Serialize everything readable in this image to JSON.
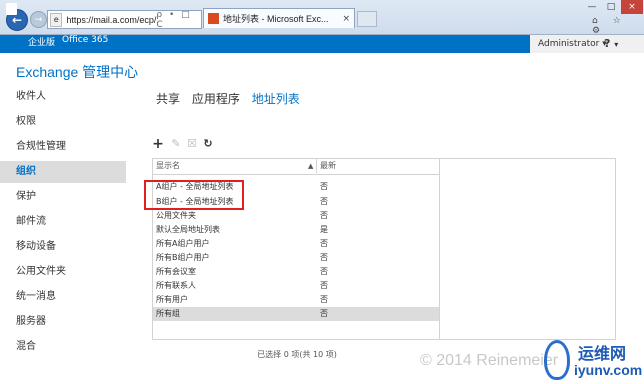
{
  "browser": {
    "url": "https://mail.a.com/ecp/",
    "address_tools": "ρ • □ C",
    "tab_title": "地址列表 - Microsoft Exc...",
    "tab_close": "×",
    "window_controls": [
      "—",
      "□",
      "×"
    ],
    "right_tools": "⌂ ☆ ⚙"
  },
  "office_bar": {
    "edition": "企业版",
    "product": "Office 365",
    "user": "Administrator",
    "user_arrow": "▾",
    "help": "?",
    "help_arrow": "▾"
  },
  "page_title": "Exchange 管理中心",
  "nav": {
    "items": [
      {
        "label": "收件人"
      },
      {
        "label": "权限"
      },
      {
        "label": "合规性管理"
      },
      {
        "label": "组织"
      },
      {
        "label": "保护"
      },
      {
        "label": "邮件流"
      },
      {
        "label": "移动设备"
      },
      {
        "label": "公用文件夹"
      },
      {
        "label": "统一消息"
      },
      {
        "label": "服务器"
      },
      {
        "label": "混合"
      }
    ],
    "active_index": 3
  },
  "subtabs": [
    {
      "label": "共享"
    },
    {
      "label": "应用程序"
    },
    {
      "label": "地址列表"
    }
  ],
  "toolbar": {
    "add": "+",
    "edit": "✎",
    "delete": "☒",
    "refresh": "↻"
  },
  "table": {
    "columns": [
      "显示名",
      "最新"
    ],
    "sort_indicator": "▲",
    "rows": [
      {
        "name": "A组户 - 全局地址列表",
        "latest": "否"
      },
      {
        "name": "B组户 - 全局地址列表",
        "latest": "否"
      },
      {
        "name": "公用文件夹",
        "latest": "否"
      },
      {
        "name": "默认全局地址列表",
        "latest": "是"
      },
      {
        "name": "所有A组户用户",
        "latest": "否"
      },
      {
        "name": "所有B组户用户",
        "latest": "否"
      },
      {
        "name": "所有会议室",
        "latest": "否"
      },
      {
        "name": "所有联系人",
        "latest": "否"
      },
      {
        "name": "所有用户",
        "latest": "否"
      },
      {
        "name": "所有组",
        "latest": "否"
      }
    ],
    "selected_index": 9,
    "status": "已选择 0 项(共 10 项)"
  },
  "watermark": {
    "copyright": "© 2014 Reinemeier",
    "site_cn": "运维网",
    "site_en": "iyunv.com"
  },
  "colors": {
    "accent": "#0072c6",
    "highlight_box": "#e02020"
  }
}
